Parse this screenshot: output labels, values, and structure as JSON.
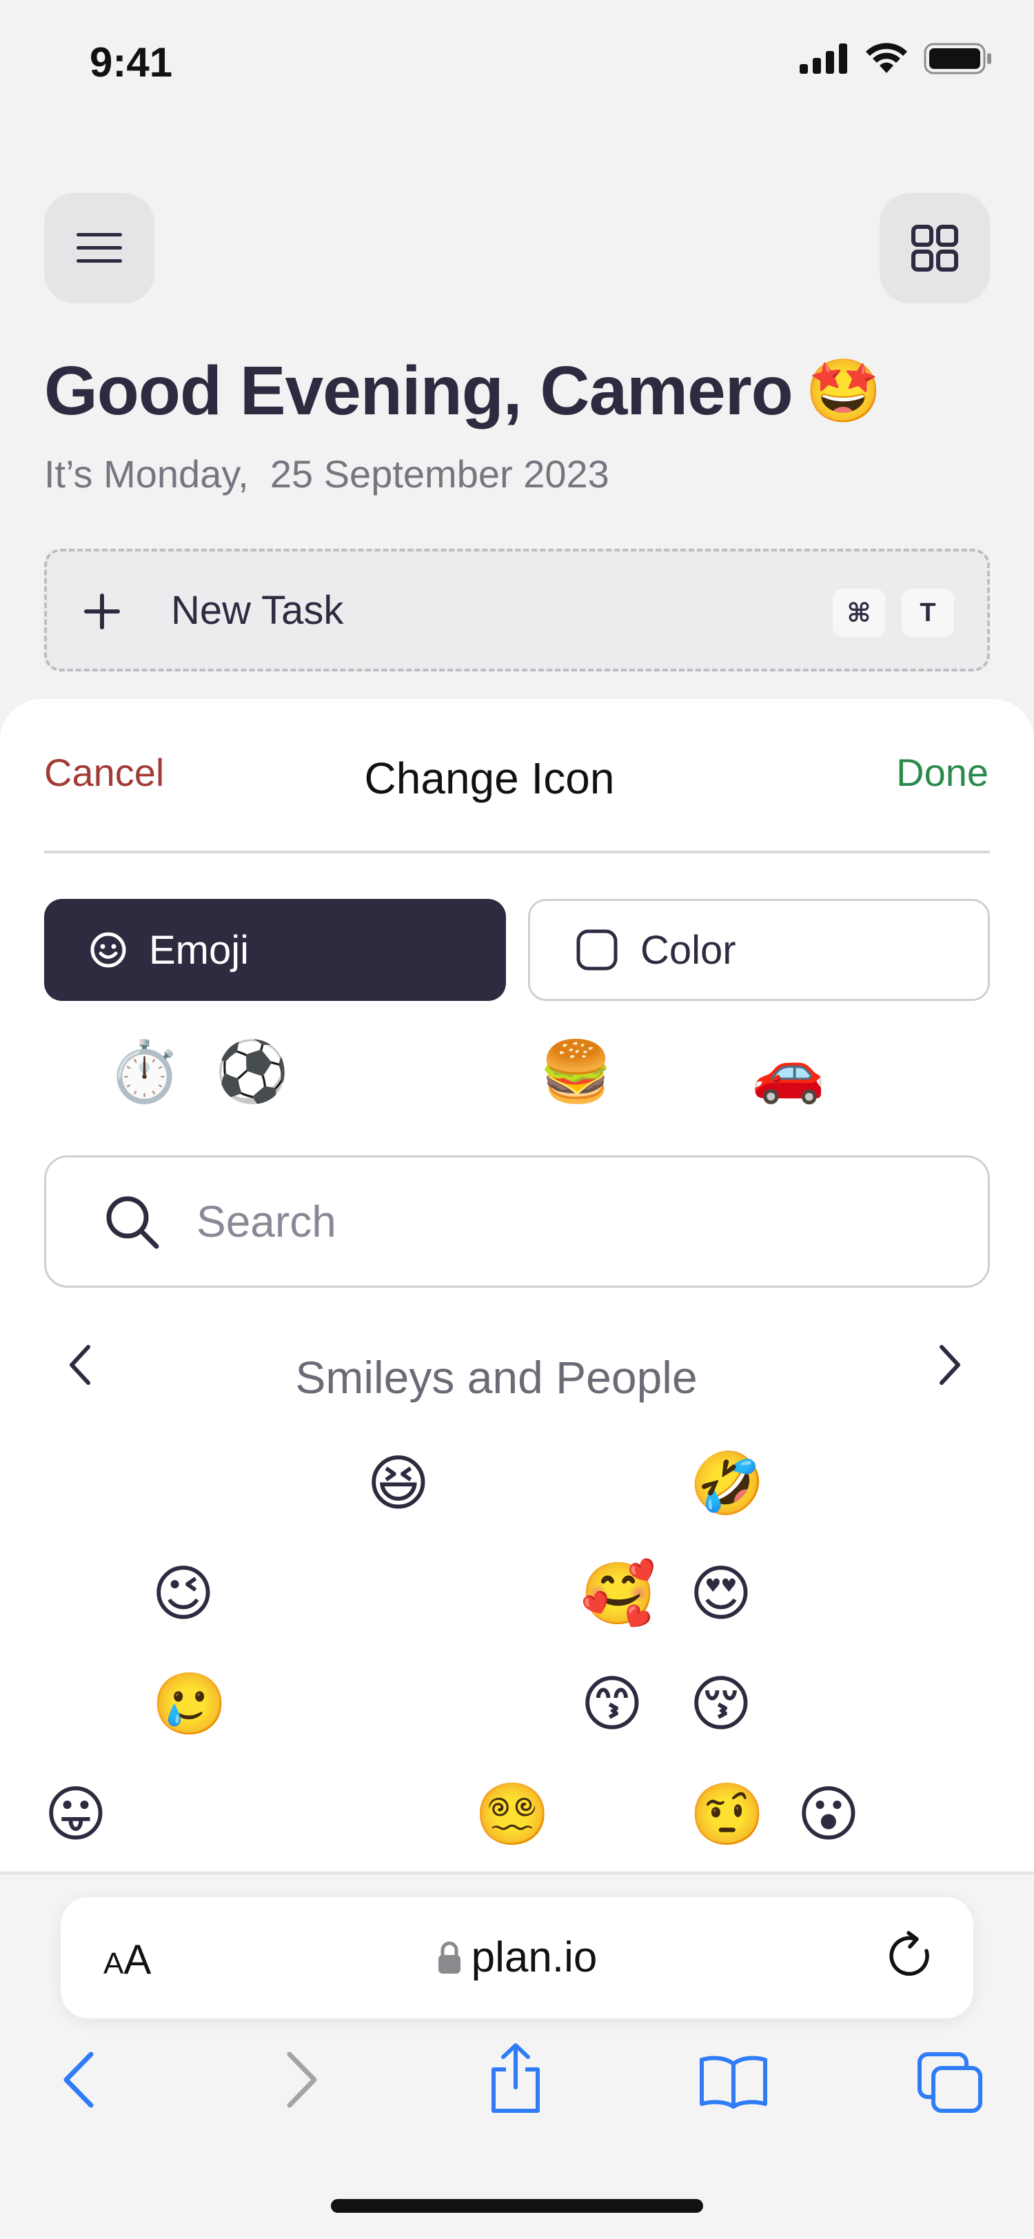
{
  "status": {
    "time": "9:41"
  },
  "header": {
    "greeting": "Good Evening, Camero",
    "greeting_emoji": "🤩",
    "date_line": "It’s Monday,  25 September 2023"
  },
  "new_task": {
    "label": "New Task",
    "shortcut_cmd": "⌘",
    "shortcut_key": "T"
  },
  "sheet": {
    "cancel": "Cancel",
    "title": "Change Icon",
    "done": "Done",
    "tabs": {
      "emoji": "Emoji",
      "color": "Color"
    },
    "category_emojis": [
      "⏱️",
      "⚽",
      "🍔",
      "🚗"
    ],
    "search_placeholder": "Search",
    "category_title": "Smileys and People",
    "emoji_grid": [
      "😆",
      "🤣",
      "😉",
      "🥰",
      "😍",
      "🥲",
      "😙",
      "😚",
      "😛",
      "😵‍💫",
      "🤨",
      "😮"
    ]
  },
  "browser": {
    "aa_small": "A",
    "aa_large": "A",
    "url": "plan.io"
  },
  "colors": {
    "primary": "#2e2b40",
    "cancel": "#a23a36",
    "done": "#2a8a4c",
    "ios_blue": "#2f7cf6"
  }
}
